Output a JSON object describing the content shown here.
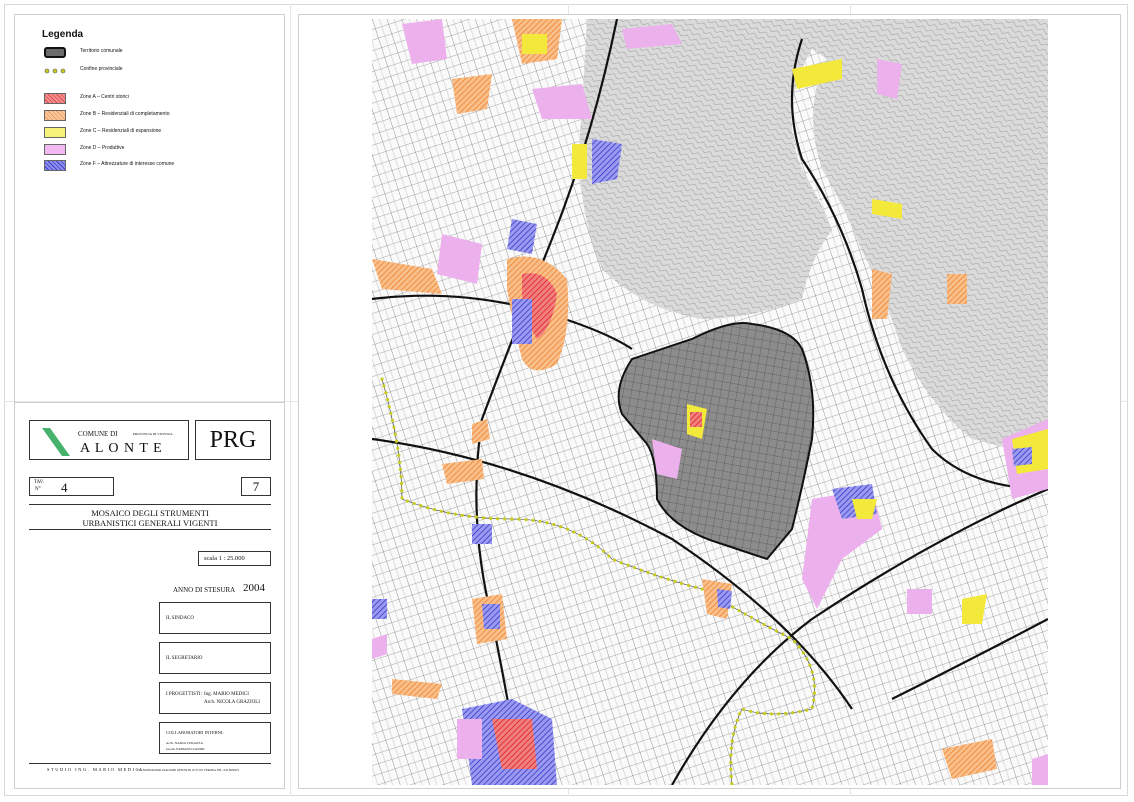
{
  "legend": {
    "title": "Legenda",
    "items": [
      {
        "label": "Territorio comunale",
        "swatch": "#6b6b6b",
        "icon": "territory-swatch"
      },
      {
        "label": "Confine provinciale",
        "swatch": "#b5b800",
        "icon": "province-border-dots"
      },
      {
        "label": "Zone A – Centri storici",
        "swatch": "#f08f8f",
        "icon": "zone-a-swatch"
      },
      {
        "label": "Zone B – Residenziali di completamento",
        "swatch": "#f5b47a",
        "icon": "zone-b-swatch"
      },
      {
        "label": "Zone C – Residenziali di espansione",
        "swatch": "#f7f27a",
        "icon": "zone-c-swatch"
      },
      {
        "label": "Zone D – Produttive",
        "swatch": "#f2b8f2",
        "icon": "zone-d-swatch"
      },
      {
        "label": "Zone F – Attrezzature di interesse comune",
        "swatch": "#6a6ae0",
        "icon": "zone-f-swatch"
      }
    ]
  },
  "title_block": {
    "comune_di": "COMUNE DI",
    "provincia": "PROVINCIA DI VICENZA",
    "comune_name": "A L O N T E",
    "plan": "PRG",
    "tav_label_1": "TAV.",
    "tav_label_2": "N°",
    "tav_number": "4",
    "sheet_number": "7",
    "subject_line1": "MOSAICO DEGLI STRUMENTI",
    "subject_line2": "URBANISTICI GENERALI VIGENTI",
    "scale_label": "scala   1 : 25.000",
    "year_label": "ANNO DI STESURA",
    "year": "2004",
    "sindaco": "IL SINDACO",
    "segretario": "IL SEGRETARIO",
    "progettisti_label": "I PROGETTISTI:",
    "progettista1": "Ing. MARIO MEDICI",
    "progettista2": "Arch. NICOLA GRAZIOLI",
    "collaboratori_label": "COLLABORATORI INTERNI:",
    "collaboratore1": "Arch. NADIA TURAZZA",
    "collaboratore2": "Geom. FABIANO ZANINI",
    "studio": "STUDIO ING. MARIO MEDICI",
    "address": "VIA MONSIGNOR GIACOMO GENTILIN 10     37132 VERONA     TEL. 045 8950071"
  },
  "colors": {
    "territory": "#6b6b6b",
    "province_border": "#b5b800",
    "zone_a": "#e23a3a",
    "zone_b": "#f59a45",
    "zone_c": "#f2e93a",
    "zone_d": "#e98ee9",
    "zone_f": "#4a4ad6",
    "logo_green": "#47b26b"
  }
}
